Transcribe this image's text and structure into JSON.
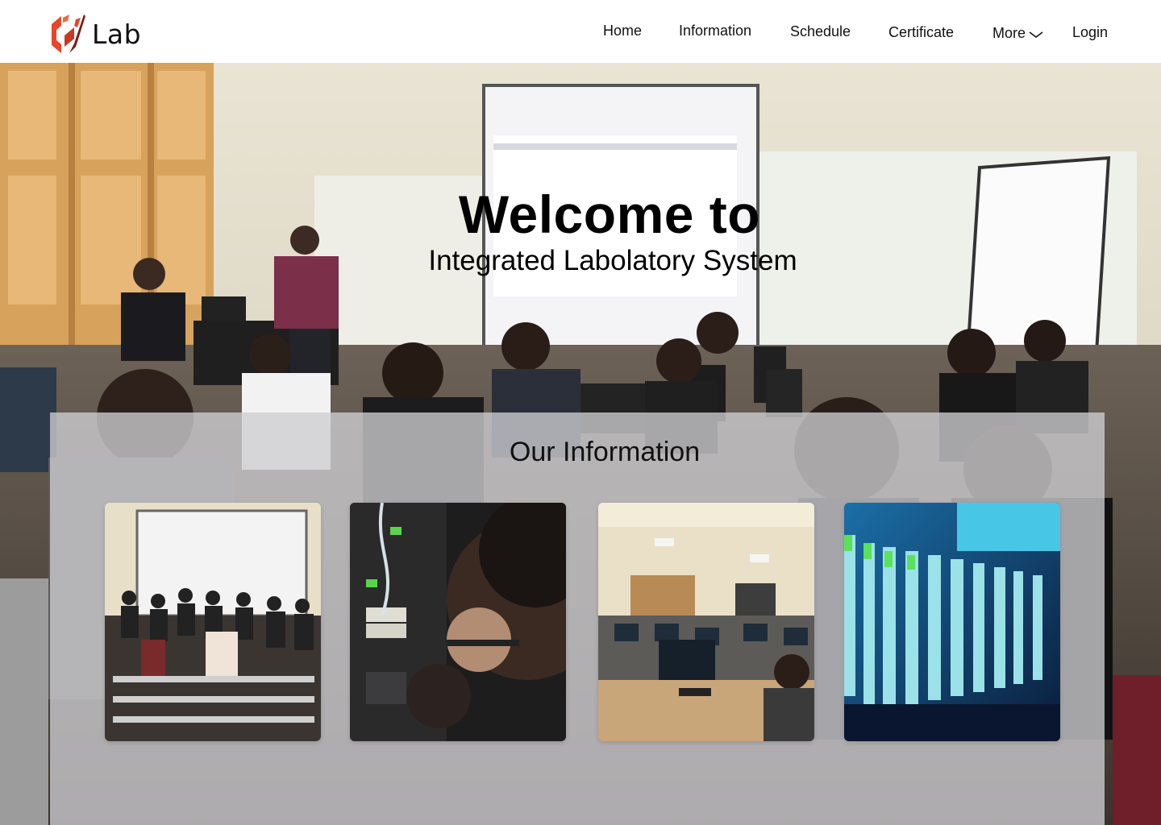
{
  "brand": {
    "logo_text": "Lab",
    "colors": {
      "logo_primary": "#e8462b",
      "logo_dark": "#7a1c10"
    }
  },
  "nav": {
    "items": [
      "Home",
      "Information",
      "Schedule",
      "Certificate"
    ],
    "more_label": "More",
    "login_label": "Login"
  },
  "hero": {
    "title": "Welcome to",
    "subtitle": "Integrated Labolatory System"
  },
  "info": {
    "title": "Our Information",
    "cards": [
      {
        "icon": "group-photo-image"
      },
      {
        "icon": "server-rack-image"
      },
      {
        "icon": "computer-lab-image"
      },
      {
        "icon": "network-cables-image"
      }
    ]
  }
}
